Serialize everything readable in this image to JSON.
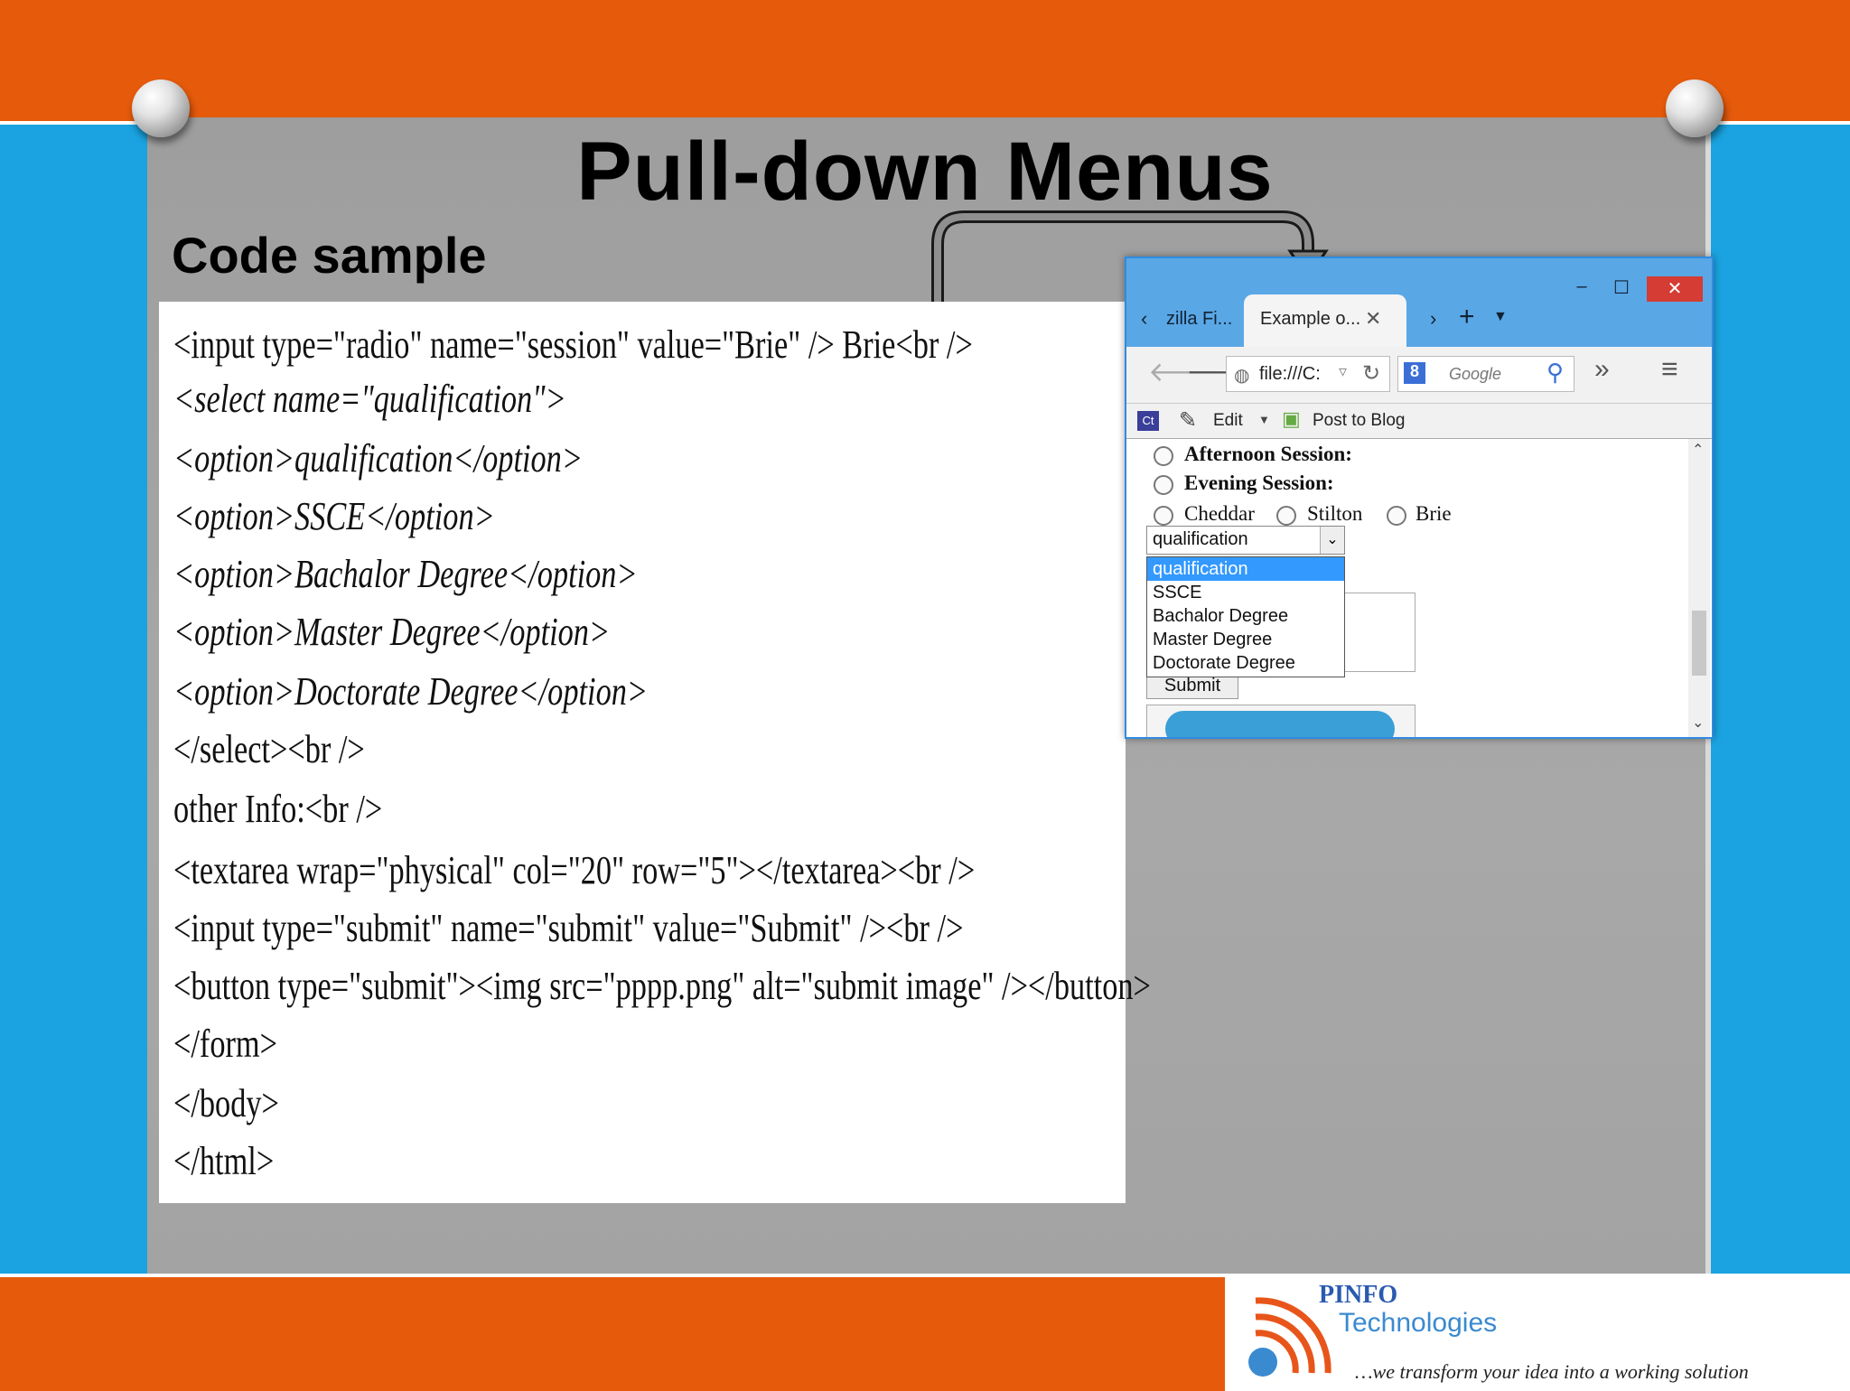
{
  "slide": {
    "title": "Pull-down Menus",
    "code_heading": "Code sample"
  },
  "code_lines": [
    "<input type=\"radio\" name=\"session\" value=\"Brie\" /> Brie<br />",
    "<select name=\"qualification\">",
    "<option>qualification</option>",
    "<option>SSCE</option>",
    "<option>Bachalor Degree</option>",
    "<option>Master Degree</option>",
    "<option>Doctorate Degree</option>",
    "</select><br />",
    "other Info:<br />",
    "<textarea wrap=\"physical\" col=\"20\" row=\"5\"></textarea><br />",
    "<input type=\"submit\" name=\"submit\" value=\"Submit\" /><br />",
    "<button type=\"submit\"><img src=\"pppp.png\" alt=\"submit image\" /></button>",
    "</form>",
    "</body>",
    "</html>"
  ],
  "browser": {
    "window_controls": {
      "minimize": "–",
      "maximize": "☐",
      "close": "✕"
    },
    "tabs": [
      {
        "label": "zilla Fi..."
      },
      {
        "label": "Example o...",
        "close": "✕"
      }
    ],
    "tab_new": "+",
    "url": "file:///C:",
    "search_engine": "8",
    "search_placeholder": "Google",
    "bookmarks": {
      "ct_label": "Ct",
      "edit_label": "Edit",
      "post_label": "Post to Blog"
    },
    "page": {
      "radio_labels": {
        "afternoon": "Afternoon Session:",
        "evening": "Evening Session:",
        "cheddar": "Cheddar",
        "stilton": "Stilton",
        "brie": "Brie"
      },
      "select_value": "qualification",
      "options": [
        "qualification",
        "SSCE",
        "Bachalor Degree",
        "Master Degree",
        "Doctorate Degree"
      ],
      "selected_index": 0,
      "submit_label": "Submit"
    }
  },
  "logo": {
    "name": "PINFO",
    "sub": "Technologies",
    "tagline": "…we transform your idea into a working solution"
  },
  "colors": {
    "orange": "#e65a0b",
    "blue": "#1aa3e0",
    "board": "#a3a3a3"
  }
}
